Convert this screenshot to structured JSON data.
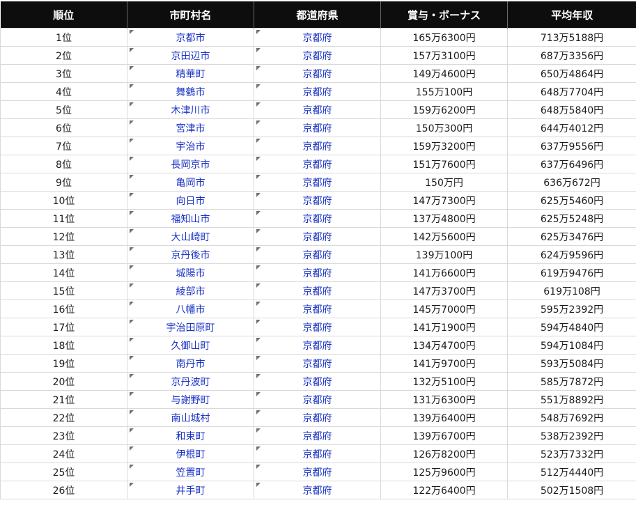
{
  "table": {
    "headers": [
      "順位",
      "市町村名",
      "都道府県",
      "賞与・ボーナス",
      "平均年収"
    ],
    "rows": [
      [
        "1位",
        "京都市",
        "京都府",
        "165万6300円",
        "713万5188円"
      ],
      [
        "2位",
        "京田辺市",
        "京都府",
        "157万3100円",
        "687万3356円"
      ],
      [
        "3位",
        "精華町",
        "京都府",
        "149万4600円",
        "650万4864円"
      ],
      [
        "4位",
        "舞鶴市",
        "京都府",
        "155万100円",
        "648万7704円"
      ],
      [
        "5位",
        "木津川市",
        "京都府",
        "159万6200円",
        "648万5840円"
      ],
      [
        "6位",
        "宮津市",
        "京都府",
        "150万300円",
        "644万4012円"
      ],
      [
        "7位",
        "宇治市",
        "京都府",
        "159万3200円",
        "637万9556円"
      ],
      [
        "8位",
        "長岡京市",
        "京都府",
        "151万7600円",
        "637万6496円"
      ],
      [
        "9位",
        "亀岡市",
        "京都府",
        "150万円",
        "636万672円"
      ],
      [
        "10位",
        "向日市",
        "京都府",
        "147万7300円",
        "625万5460円"
      ],
      [
        "11位",
        "福知山市",
        "京都府",
        "137万4800円",
        "625万5248円"
      ],
      [
        "12位",
        "大山崎町",
        "京都府",
        "142万5600円",
        "625万3476円"
      ],
      [
        "13位",
        "京丹後市",
        "京都府",
        "139万100円",
        "624万9596円"
      ],
      [
        "14位",
        "城陽市",
        "京都府",
        "141万6600円",
        "619万9476円"
      ],
      [
        "15位",
        "綾部市",
        "京都府",
        "147万3700円",
        "619万108円"
      ],
      [
        "16位",
        "八幡市",
        "京都府",
        "145万7000円",
        "595万2392円"
      ],
      [
        "17位",
        "宇治田原町",
        "京都府",
        "141万1900円",
        "594万4840円"
      ],
      [
        "18位",
        "久御山町",
        "京都府",
        "134万4700円",
        "594万1084円"
      ],
      [
        "19位",
        "南丹市",
        "京都府",
        "141万9700円",
        "593万5084円"
      ],
      [
        "20位",
        "京丹波町",
        "京都府",
        "132万5100円",
        "585万7872円"
      ],
      [
        "21位",
        "与謝野町",
        "京都府",
        "131万6300円",
        "551万8892円"
      ],
      [
        "22位",
        "南山城村",
        "京都府",
        "139万6400円",
        "548万7692円"
      ],
      [
        "23位",
        "和束町",
        "京都府",
        "139万6700円",
        "538万2392円"
      ],
      [
        "24位",
        "伊根町",
        "京都府",
        "126万8200円",
        "523万7332円"
      ],
      [
        "25位",
        "笠置町",
        "京都府",
        "125万9600円",
        "512万4440円"
      ],
      [
        "26位",
        "井手町",
        "京都府",
        "122万6400円",
        "502万1508円"
      ]
    ]
  },
  "colors": {
    "header_bg": "#0d0d0d",
    "header_text": "#ffffff",
    "link_text": "#1a33c4",
    "cell_text": "#1a1a1a",
    "grid": "#d9d9d9"
  }
}
